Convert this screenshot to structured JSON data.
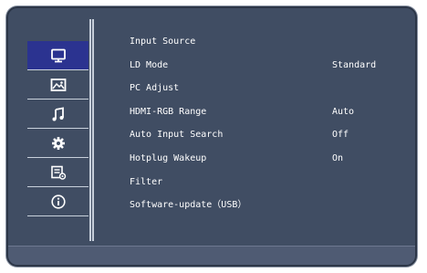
{
  "sidebar": {
    "items": [
      {
        "icon": "monitor-icon",
        "active": true
      },
      {
        "icon": "picture-icon",
        "active": false
      },
      {
        "icon": "music-icon",
        "active": false
      },
      {
        "icon": "gear-icon",
        "active": false
      },
      {
        "icon": "settings-list-icon",
        "active": false
      },
      {
        "icon": "info-icon",
        "active": false
      }
    ]
  },
  "menu": {
    "items": [
      {
        "label": "Input Source",
        "value": ""
      },
      {
        "label": "LD Mode",
        "value": "Standard"
      },
      {
        "label": "PC Adjust",
        "value": ""
      },
      {
        "label": "HDMI-RGB Range",
        "value": "Auto"
      },
      {
        "label": "Auto Input Search",
        "value": "Off"
      },
      {
        "label": "Hotplug Wakeup",
        "value": "On"
      },
      {
        "label": "Filter",
        "value": ""
      },
      {
        "label": "Software-update（USB）",
        "value": ""
      }
    ]
  },
  "colors": {
    "panel": "#404d63",
    "active_tab": "#2b3390",
    "text": "#ffffff"
  }
}
